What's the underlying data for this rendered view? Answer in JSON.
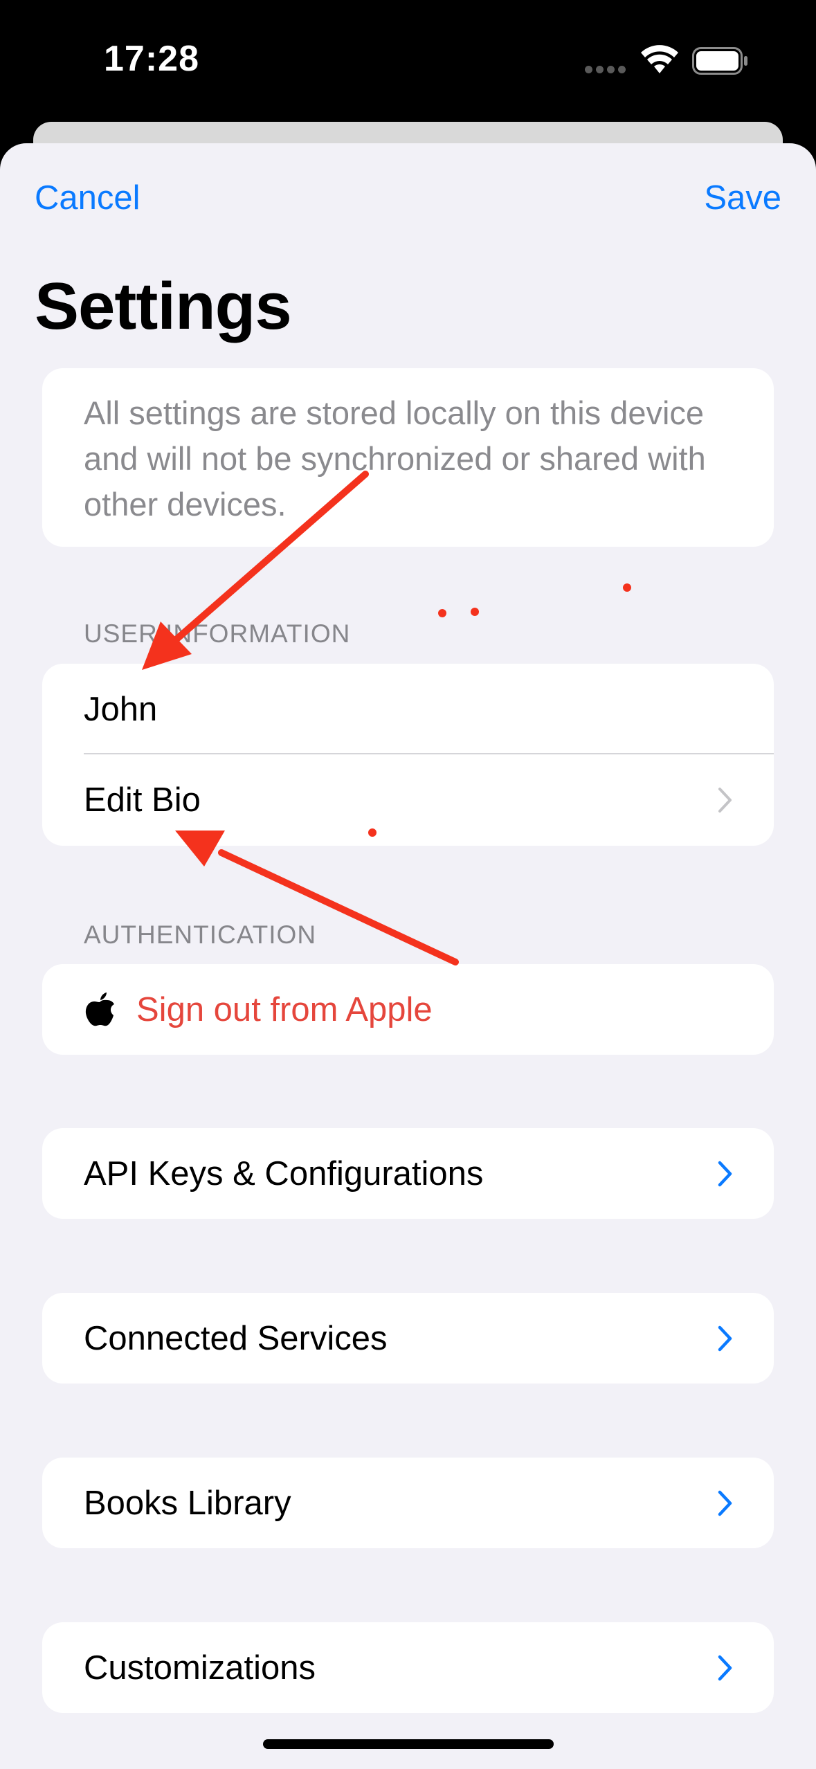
{
  "status_bar": {
    "time": "17:28"
  },
  "nav": {
    "cancel_label": "Cancel",
    "save_label": "Save",
    "title": "Settings"
  },
  "info": {
    "text": "All settings are stored locally on this device and will not be synchronized or shared with other devices."
  },
  "user_information": {
    "header": "USER INFORMATION",
    "name_value": "John",
    "edit_bio_label": "Edit Bio"
  },
  "authentication": {
    "header": "AUTHENTICATION",
    "sign_out_label": "Sign out from Apple"
  },
  "menu": {
    "api_keys_label": "API Keys & Configurations",
    "connected_services_label": "Connected Services",
    "books_library_label": "Books Library",
    "customizations_label": "Customizations"
  },
  "icons": {
    "chevron_blue": "chevron-right-icon",
    "chevron_gray": "chevron-right-icon",
    "apple": "apple-logo-icon",
    "wifi": "wifi-icon",
    "battery": "battery-icon",
    "signal": "cellular-signal-icon"
  },
  "colors": {
    "accent": "#0a7aff",
    "destructive": "#e5463c",
    "annotation": "#f4321d",
    "background": "#f2f1f7"
  }
}
